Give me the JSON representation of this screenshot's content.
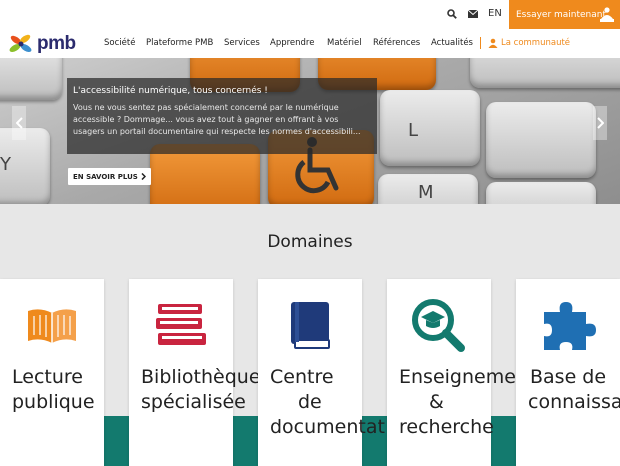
{
  "colors": {
    "accent": "#ef8a1d",
    "teal": "#137a6e",
    "brand": "#2b2b6e"
  },
  "topbar": {
    "lang": "EN",
    "cta_label": "Essayer maintenant"
  },
  "logo": {
    "text": "pmb"
  },
  "nav": {
    "items": [
      "Société",
      "Plateforme PMB",
      "Services",
      "Apprendre",
      "Matériel",
      "Références",
      "Actualités"
    ],
    "community": "La communauté"
  },
  "hero": {
    "title": "L'accessibilité numérique, tous concernés !",
    "text": "Vous ne vous sentez pas spécialement concerné par le numérique accessible ? Dommage... vous avez tout à gagner en offrant à vos usagers un portail documentaire qui respecte les normes d'accessibili...",
    "button": "EN SAVOIR PLUS"
  },
  "domains": {
    "title": "Domaines",
    "cards": [
      {
        "icon": "open-book-icon",
        "lines": [
          "Lecture",
          "publique"
        ]
      },
      {
        "icon": "books-stack-icon",
        "lines": [
          "Bibliothèque",
          "spécialisée"
        ]
      },
      {
        "icon": "closed-book-icon",
        "lines": [
          "Centre",
          "de",
          "documentat"
        ]
      },
      {
        "icon": "magnifier-graduation-icon",
        "lines": [
          "Enseigneme",
          "&",
          "recherche"
        ]
      },
      {
        "icon": "puzzle-piece-icon",
        "lines": [
          "Base de",
          "connaissa"
        ]
      }
    ]
  }
}
